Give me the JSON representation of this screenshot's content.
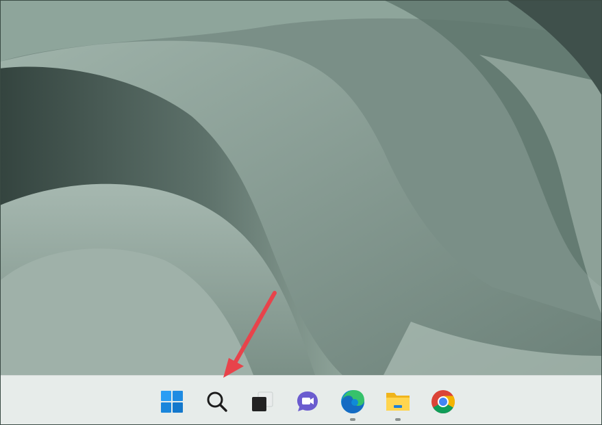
{
  "desktop": {
    "wallpaper": "windows-11-bloom-wallpaper-sage"
  },
  "taskbar": {
    "items": [
      {
        "name": "start",
        "icon": "windows-start-icon",
        "running": false
      },
      {
        "name": "search",
        "icon": "search-icon",
        "running": false
      },
      {
        "name": "task-view",
        "icon": "task-view-icon",
        "running": false
      },
      {
        "name": "chat",
        "icon": "teams-chat-icon",
        "running": false
      },
      {
        "name": "edge",
        "icon": "edge-browser-icon",
        "running": true
      },
      {
        "name": "file-explorer",
        "icon": "file-explorer-icon",
        "running": true
      },
      {
        "name": "chrome",
        "icon": "chrome-browser-icon",
        "running": false
      }
    ]
  },
  "annotation": {
    "arrow_color": "#e8434b",
    "points_to": "search"
  },
  "colors": {
    "taskbar_bg": "#e7ecea",
    "start_blue": "#1a8fe3",
    "chat_purple": "#6b5ccf"
  }
}
